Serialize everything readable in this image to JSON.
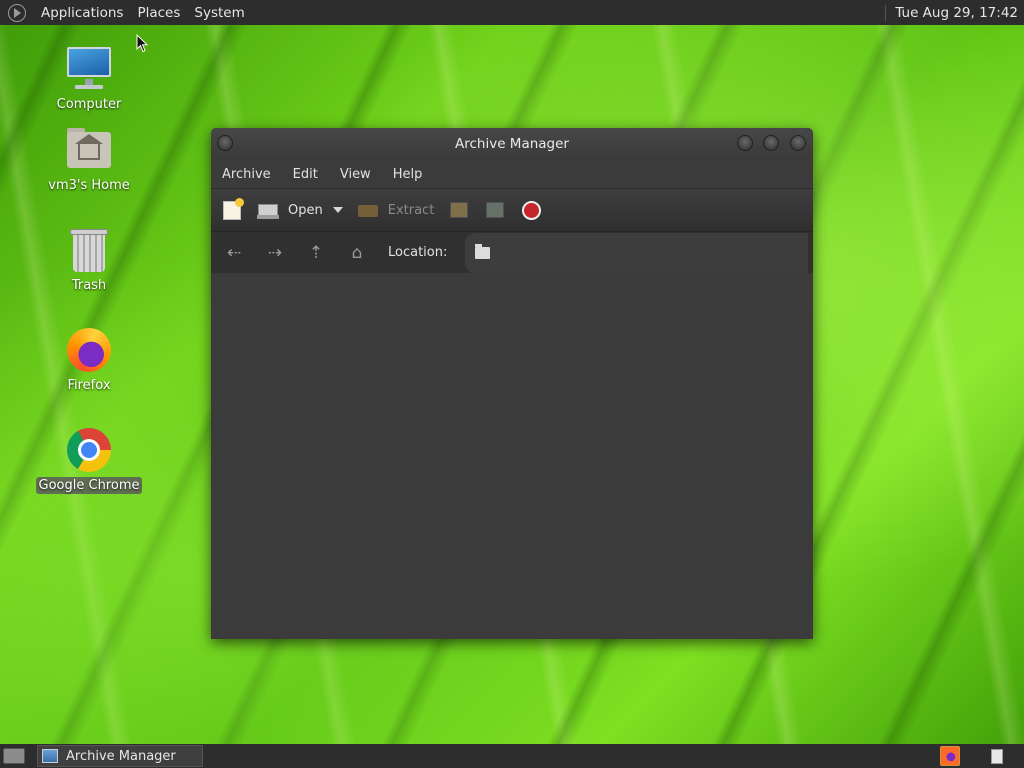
{
  "top_panel": {
    "menus": [
      "Applications",
      "Places",
      "System"
    ],
    "clock": "Tue Aug 29, 17:42"
  },
  "desktop": {
    "icons": [
      {
        "label": "Computer",
        "icon": "computer-icon"
      },
      {
        "label": "vm3's Home",
        "icon": "home-folder-icon"
      },
      {
        "label": "Trash",
        "icon": "trash-icon"
      },
      {
        "label": "Firefox",
        "icon": "firefox-icon"
      },
      {
        "label": "Google Chrome",
        "icon": "chrome-icon",
        "selected": true
      }
    ]
  },
  "window": {
    "title": "Archive Manager",
    "menubar": [
      "Archive",
      "Edit",
      "View",
      "Help"
    ],
    "toolbar": {
      "open_label": "Open",
      "extract_label": "Extract",
      "extract_enabled": false
    },
    "location": {
      "label": "Location:",
      "value": ""
    }
  },
  "taskbar": {
    "tasks": [
      {
        "label": "Archive Manager"
      }
    ]
  },
  "colors": {
    "panel_bg": "#2d2d2d",
    "window_bg": "#3b3b3b",
    "stop_red": "#c4262c"
  }
}
